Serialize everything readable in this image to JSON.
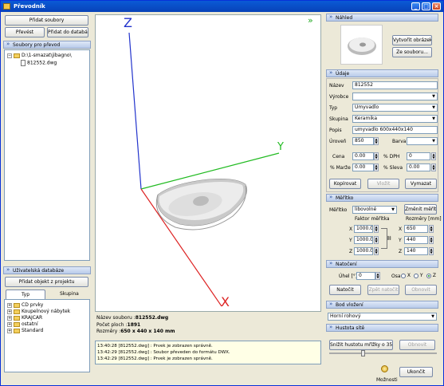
{
  "window": {
    "title": "Převodník"
  },
  "left": {
    "add_files": "Přidat soubory",
    "convert": "Převést",
    "add_to_db": "Přidat do databáze",
    "files_header": "Soubory pro převod",
    "tree_folder": "D:\\1-smazat\\jibagno\\",
    "tree_file": "812552.dwg",
    "userdb_header": "Uživatelská databáze",
    "add_from_project": "Přidat objekt z projektu",
    "tab_type": "Typ",
    "tab_group": "Skupina",
    "db_items": [
      "CD prvky",
      "Koupelnový nábytek",
      "KRAJCAR",
      "ostatní",
      "Standard"
    ]
  },
  "viewport": {
    "axis_z": "Z",
    "axis_y": "Y",
    "axis_x": "X",
    "arrow": "»"
  },
  "info": {
    "name_label": "Název souboru :",
    "name_value": "812552.dwg",
    "faces_label": "Počet ploch :",
    "faces_value": "1891",
    "dims_label": "Rozměry :",
    "dims_value": "650 x 440 x 140 mm"
  },
  "log": [
    "13:40:28 [812552.dwg] : Prvek je zobrazen správně.",
    "13:42:29 [812552.dwg] : Soubor převeden do formátu DWX.",
    "13:42:29 [812552.dwg] : Prvek je zobrazen správně."
  ],
  "right": {
    "preview_header": "Náhled",
    "create_image": "Vytvořit obrázek",
    "from_file": "Ze souboru...",
    "data_header": "Údaje",
    "name_l": "Název",
    "name_v": "812552",
    "maker_l": "Výrobce",
    "maker_v": "",
    "type_l": "Typ",
    "type_v": "Umyvadlo",
    "group_l": "Skupina",
    "group_v": "Keramika",
    "desc_l": "Popis",
    "desc_v": "umyvadlo 600x440x140",
    "level_l": "Úroveň",
    "level_v": "850",
    "color_l": "Barva",
    "price_l": "Cena",
    "price_v": "0.00",
    "vat_l": "% DPH",
    "vat_v": "0",
    "margin_l": "% Marže",
    "margin_v": "0.00",
    "disc_l": "% Sleva",
    "disc_v": "0.00",
    "copy": "Kopírovat",
    "paste": "Vložit",
    "clear": "Vymazat",
    "scale_header": "Měřítko",
    "scale_l": "Měřítko",
    "scale_v": "libovolné",
    "change_scale": "Změnit měřítko",
    "factor_l": "Faktor měřítka",
    "dims_l": "Rozměry [mm]",
    "fx": "1000.00",
    "fy": "1000.00",
    "fz": "1000.00",
    "dx": "650",
    "dy": "440",
    "dz": "140",
    "ax_x": "X",
    "ax_y": "Y",
    "ax_z": "Z",
    "rot_header": "Natočení",
    "angle_l": "Úhel [°]",
    "angle_v": "0",
    "axis_l": "Osa",
    "rotate": "Natočit",
    "undo_rotate": "Zpět natočit",
    "refresh": "Obnovit",
    "insert_header": "Bod vložení",
    "insert_v": "Horní rohový",
    "density_header": "Hustota sítě",
    "reduce_density": "Snížit hustotu mřížky o 35%",
    "refresh2": "Obnovit",
    "options": "Možnosti",
    "finish": "Ukončit"
  }
}
